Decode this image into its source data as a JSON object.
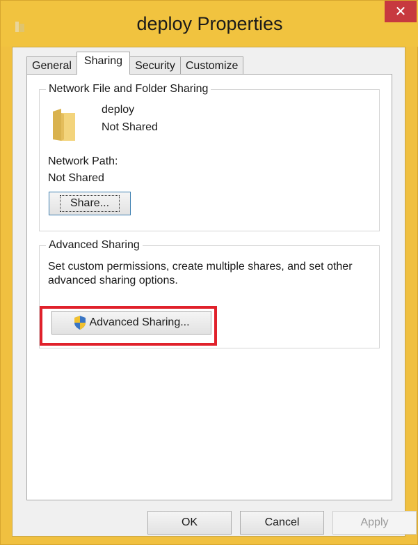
{
  "window": {
    "title": "deploy Properties",
    "close_label": "✕"
  },
  "tabs": [
    {
      "label": "General"
    },
    {
      "label": "Sharing",
      "active": true
    },
    {
      "label": "Security"
    },
    {
      "label": "Customize"
    }
  ],
  "network_sharing": {
    "legend": "Network File and Folder Sharing",
    "folder_name": "deploy",
    "folder_status": "Not Shared",
    "network_path_label": "Network Path:",
    "network_path_value": "Not Shared",
    "share_button": "Share..."
  },
  "advanced_sharing": {
    "legend": "Advanced Sharing",
    "description": "Set custom permissions, create multiple shares, and set other advanced sharing options.",
    "button_label": "Advanced Sharing..."
  },
  "footer": {
    "ok": "OK",
    "cancel": "Cancel",
    "apply": "Apply"
  },
  "colors": {
    "titlebar": "#f1c33f",
    "close": "#c7393f",
    "highlight": "#e0212b"
  }
}
